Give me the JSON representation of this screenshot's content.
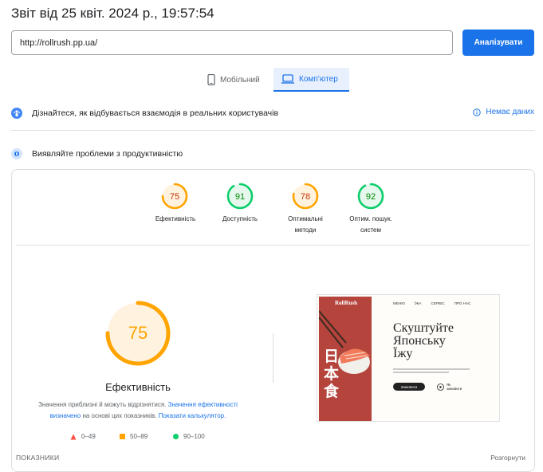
{
  "report_title": "Звіт від 25 квіт. 2024 р., 19:57:54",
  "url_input": {
    "value": "http://rollrush.pp.ua/"
  },
  "analyze_button": "Аналізувати",
  "tabs": [
    {
      "label": "Мобільний",
      "active": false
    },
    {
      "label": "Комп’ютер",
      "active": true
    }
  ],
  "field_data": {
    "label": "Дізнайтеся, як відбувається взаємодія в реальних користувачів",
    "no_data": "Немає даних"
  },
  "diagnose": {
    "label": "Виявляйте проблеми з продуктивністю"
  },
  "scores": [
    {
      "value": "75",
      "label_line1": "Ефективність",
      "label_line2": "",
      "color": "#ffa400"
    },
    {
      "value": "91",
      "label_line1": "Доступність",
      "label_line2": "",
      "color": "#0cce6b"
    },
    {
      "value": "78",
      "label_line1": "Оптимальні",
      "label_line2": "методи",
      "color": "#ffa400"
    },
    {
      "value": "92",
      "label_line1": "Оптим. пошук.",
      "label_line2": "систем",
      "color": "#0cce6b"
    }
  ],
  "score_fractions": [
    0.75,
    0.91,
    0.78,
    0.92
  ],
  "main_gauge": {
    "value": "75",
    "label": "Ефективність",
    "fraction": 0.75
  },
  "description": {
    "text1": "Значення приблизні й можуть відрізнятися. ",
    "link1_a": "Значення ефективності",
    "link1_b": "визначено",
    "text2": " на основі цих показників. ",
    "link2": "Показати калькулятор."
  },
  "legend": [
    {
      "range": "0–49",
      "color": "#ff4e42"
    },
    {
      "range": "50–89",
      "color": "#ffa400"
    },
    {
      "range": "90–100",
      "color": "#0cce6b"
    }
  ],
  "preview": {
    "brand": "RollRush",
    "nav": [
      "МЕНЮ",
      "ЇЖА",
      "СЕРВІС",
      "ПРО НАС"
    ],
    "headline": [
      "Скуштуйте",
      "Японську",
      "Їжу"
    ],
    "kanji": [
      "日",
      "本",
      "食"
    ],
    "order_button": "Замовити",
    "watch_label": "Як замовити"
  },
  "footer": {
    "metrics_label": "ПОКАЗНИКИ",
    "expand_label": "Розгорнути"
  }
}
